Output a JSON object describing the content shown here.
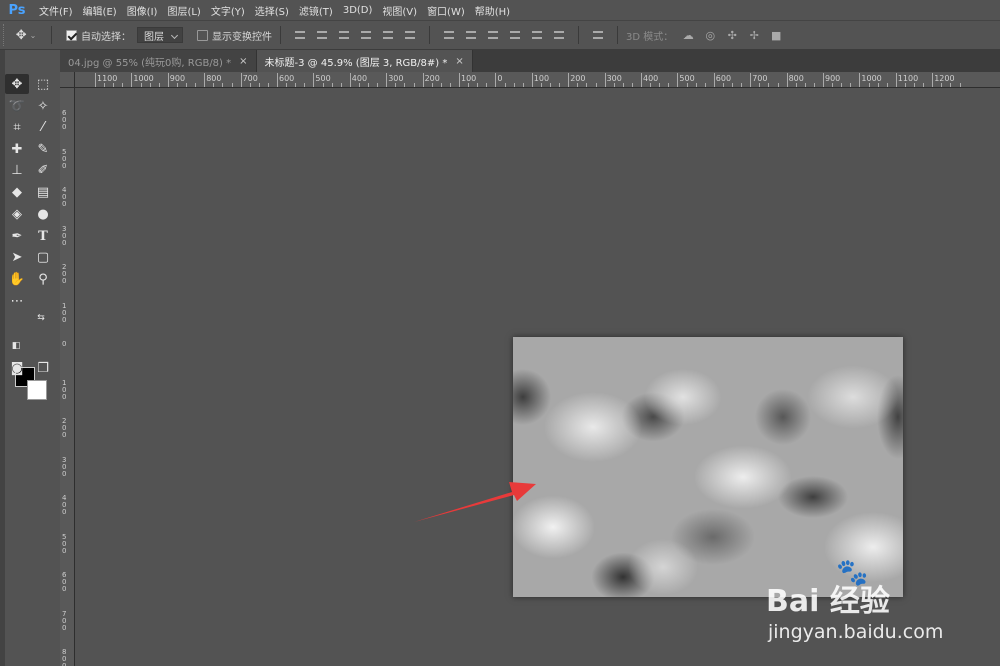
{
  "app": {
    "logo": "Ps"
  },
  "menu": [
    "文件(F)",
    "编辑(E)",
    "图像(I)",
    "图层(L)",
    "文字(Y)",
    "选择(S)",
    "滤镜(T)",
    "3D(D)",
    "视图(V)",
    "窗口(W)",
    "帮助(H)"
  ],
  "options": {
    "auto_select_label": "自动选择：",
    "auto_select_checked": true,
    "auto_select_target": "图层",
    "show_transform_label": "显示变换控件",
    "show_transform_checked": false,
    "mode_3d_label": "3D 模式："
  },
  "tabs": [
    {
      "label": "04.jpg @ 55% (纯玩0购, RGB/8) *",
      "active": false,
      "close": "×"
    },
    {
      "label": "未标题-3 @ 45.9% (图层 3, RGB/8#) *",
      "active": true,
      "close": "×"
    }
  ],
  "ruler_h": [
    "1100",
    "1000",
    "900",
    "800",
    "700",
    "600",
    "500",
    "400",
    "300",
    "200",
    "100",
    "0",
    "100",
    "200",
    "300",
    "400",
    "500",
    "600",
    "700",
    "800",
    "900",
    "1000",
    "1100",
    "1200"
  ],
  "ruler_v": [
    "600",
    "500",
    "400",
    "300",
    "200",
    "100",
    "0",
    "100",
    "200",
    "300",
    "400",
    "500",
    "600",
    "700",
    "800"
  ],
  "colors": {
    "foreground": "#000000",
    "background": "#ffffff",
    "arrow": "#e83a3a"
  },
  "watermark": {
    "brand": "Bai 经验",
    "url": "jingyan.baidu.com"
  }
}
